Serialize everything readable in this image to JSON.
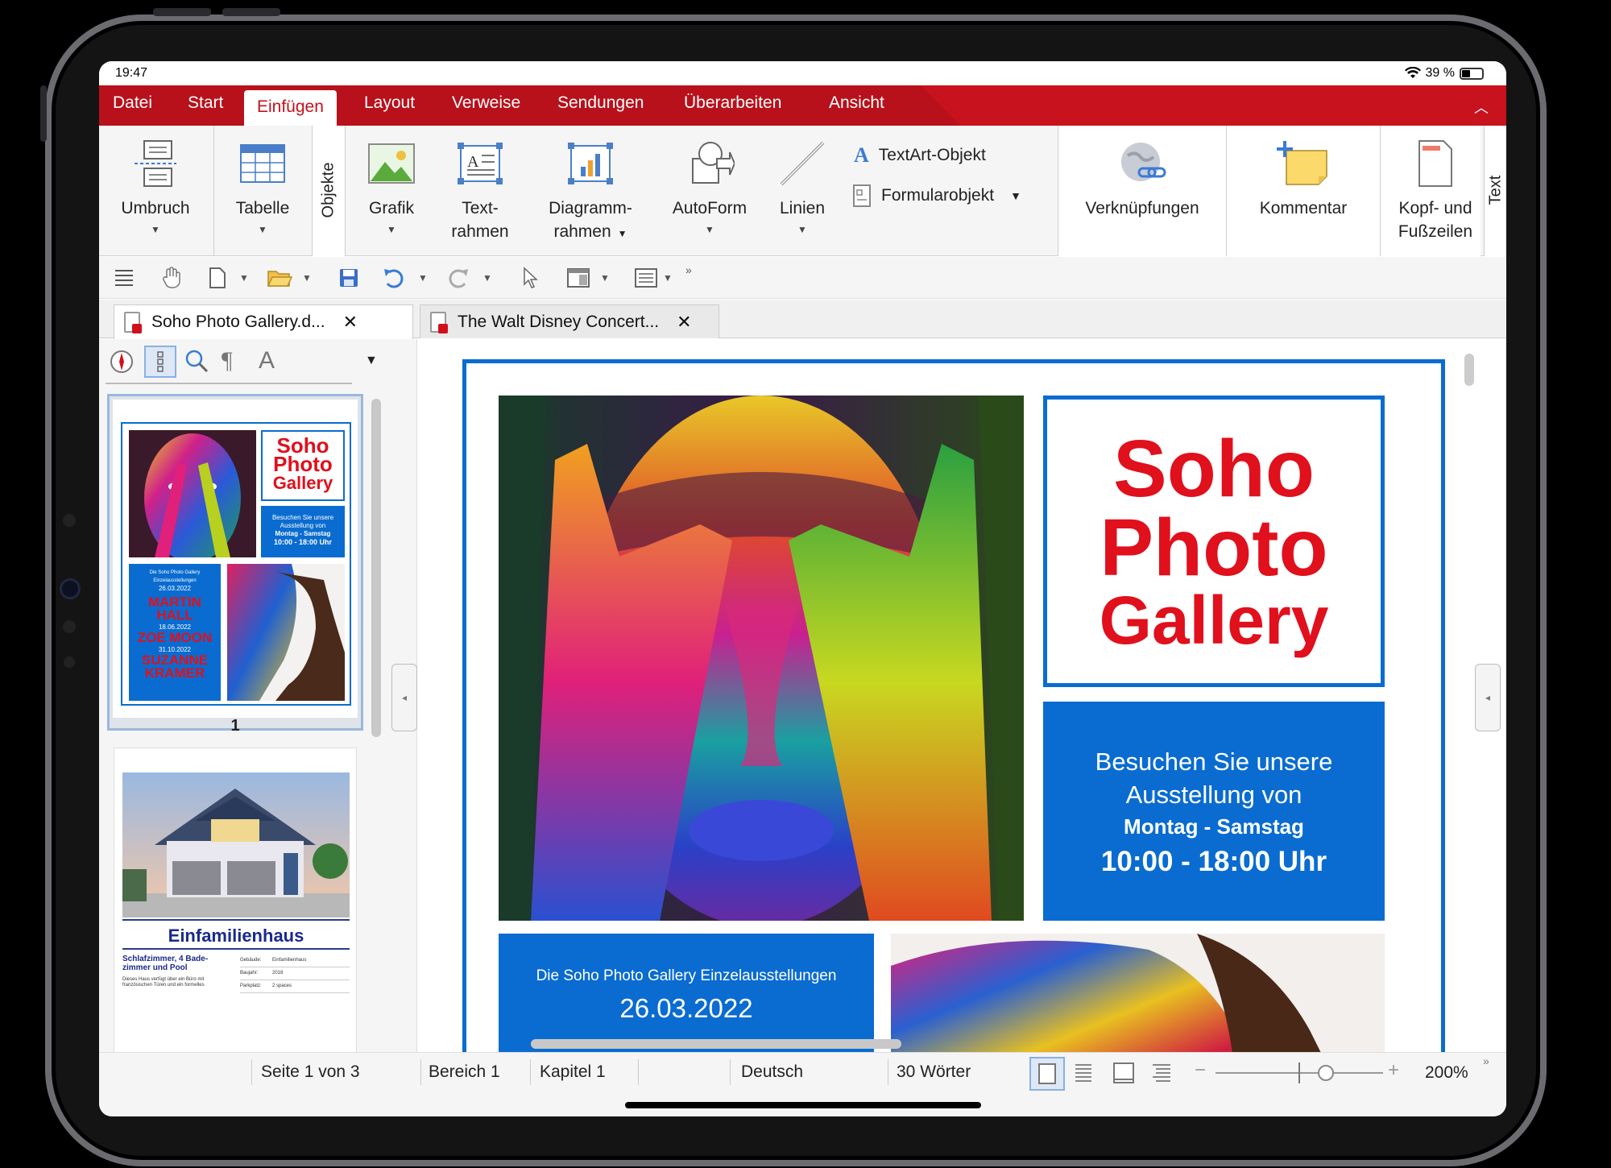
{
  "status": {
    "time": "19:47",
    "battery": "39 %"
  },
  "menu": [
    "Datei",
    "Start",
    "Einfügen",
    "Layout",
    "Verweise",
    "Sendungen",
    "Überarbeiten",
    "Ansicht"
  ],
  "ribbon": {
    "umbruch": "Umbruch",
    "tabelle": "Tabelle",
    "objekte": "Objekte",
    "grafik": "Grafik",
    "textrahmen_1": "Text-",
    "textrahmen_2": "rahmen",
    "diagramm_1": "Diagramm-",
    "diagramm_2": "rahmen",
    "autoform": "AutoForm",
    "linien": "Linien",
    "textart": "TextArt-Objekt",
    "formular": "Formularobjekt",
    "verknuepfungen": "Verknüpfungen",
    "kommentar": "Kommentar",
    "kopf_1": "Kopf- und",
    "kopf_2": "Fußzeilen",
    "text_vertical": "Text"
  },
  "tabs": [
    {
      "label": "Soho Photo Gallery.d..."
    },
    {
      "label": "The Walt Disney Concert..."
    }
  ],
  "thumbnails": {
    "page1_number": "1",
    "t1_title_1": "Soho",
    "t1_title_2": "Photo",
    "t1_title_3": "Gallery",
    "t1_visit_1": "Besuchen Sie unsere",
    "t1_visit_2": "Ausstellung von",
    "t1_visit_3": "Montag - Samstag",
    "t1_visit_4": "10:00 - 18:00 Uhr",
    "t1_info": "Die Soho Photo Gallery  Einzelausstellungen",
    "t1_date1": "26.03.2022",
    "t1_name1": "MARTIN HALL",
    "t1_date2": "18.06.2022",
    "t1_name2": "ZOE MOON",
    "t1_date3": "31.10.2022",
    "t1_name3": "SUZANNE KRAMER",
    "t2_title": "Einfamilienhaus",
    "t2_sub": "Schlafzimmer, 4 Bade-zimmer und Pool",
    "t2_body": "Dieses Haus verfügt über ein Büro mit französischen Türen und ein formelles",
    "t2_table": [
      [
        "Gebäude:",
        "Einfamilienhaus"
      ],
      [
        "Baujahr:",
        "2018"
      ],
      [
        "Parkplatz:",
        "2 spaces"
      ]
    ]
  },
  "document": {
    "title_1": "Soho",
    "title_2": "Photo",
    "title_3": "Gallery",
    "visit_1": "Besuchen Sie unsere",
    "visit_2": "Ausstellung von",
    "visit_3": "Montag - Samstag",
    "visit_4": "10:00 - 18:00 Uhr",
    "info": "Die Soho Photo Gallery  Einzelausstellungen",
    "date": "26.03.2022"
  },
  "statusbar": {
    "page": "Seite 1 von 3",
    "bereich": "Bereich 1",
    "kapitel": "Kapitel 1",
    "sprache": "Deutsch",
    "woerter": "30 Wörter",
    "zoom": "200%"
  },
  "colors": {
    "brand": "#b8111b",
    "accent_blue": "#0a6cd0",
    "title_red": "#e0101c"
  }
}
